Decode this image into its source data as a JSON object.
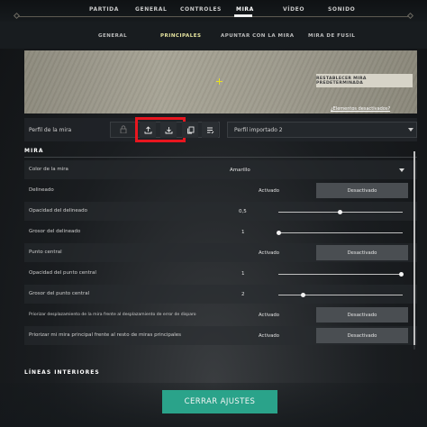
{
  "topnav": {
    "items": [
      "PARTIDA",
      "GENERAL",
      "CONTROLES",
      "MIRA",
      "VÍDEO",
      "SONIDO"
    ],
    "active_index": 3
  },
  "subnav": {
    "items": [
      "GENERAL",
      "PRINCIPALES",
      "APUNTAR CON LA MIRA",
      "MIRA DE FUSIL"
    ],
    "active_index": 1
  },
  "preview": {
    "reset_button": "RESTABLECER MIRA PREDETERMINADA",
    "hidden_elements_link": "¿Elementos desactivados?"
  },
  "profile": {
    "label": "Perfil de la mira",
    "selected": "Perfil importado 2",
    "icons": [
      "lock-icon",
      "upload-icon",
      "download-icon",
      "copy-icon",
      "list-edit-icon"
    ]
  },
  "section_mira": {
    "title": "MIRA",
    "rows": {
      "color": {
        "label": "Color de la mira",
        "value": "Amarillo"
      },
      "outline": {
        "label": "Delineado",
        "on": "Activado",
        "off": "Desactivado",
        "selected": "off"
      },
      "outline_opacity": {
        "label": "Opacidad del delineado",
        "value": "0,5",
        "fraction": 0.5
      },
      "outline_thickness": {
        "label": "Grosor del delineado",
        "value": "1",
        "fraction": 0.0
      },
      "center_dot": {
        "label": "Punto central",
        "on": "Activado",
        "off": "Desactivado",
        "selected": "off"
      },
      "center_dot_opacity": {
        "label": "Opacidad del punto central",
        "value": "1",
        "fraction": 1.0
      },
      "center_dot_thickness": {
        "label": "Grosor del punto central",
        "value": "2",
        "fraction": 0.2
      },
      "prioritize_offset": {
        "label": "Priorizar desplazamiento de la mira frente al desplazamiento de error de disparo",
        "on": "Activado",
        "off": "Desactivado",
        "selected": "off"
      },
      "prioritize_primary": {
        "label": "Priorizar mi mira principal frente al resto de miras principales",
        "on": "Activado",
        "off": "Desactivado",
        "selected": "off"
      }
    }
  },
  "section_inner": {
    "title": "LÍNEAS INTERIORES"
  },
  "close_button": "CERRAR AJUSTES",
  "colors": {
    "accent": "#2aa38a",
    "highlight": "#e8161f",
    "crosshair": "#e8e020"
  }
}
